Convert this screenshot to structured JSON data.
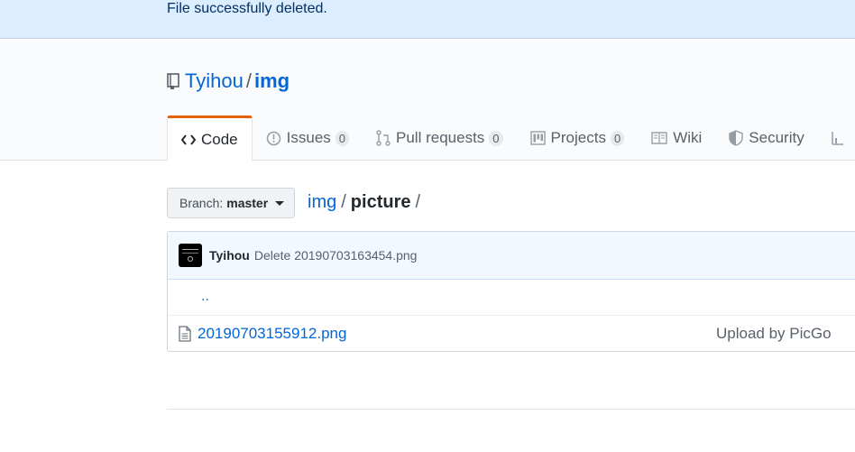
{
  "flash": {
    "message": "File successfully deleted."
  },
  "repo": {
    "owner": "Tyihou",
    "separator": "/",
    "name": "img"
  },
  "tabs": [
    {
      "label": "Code",
      "icon": "code-icon",
      "selected": true
    },
    {
      "label": "Issues",
      "icon": "issue-icon",
      "count": "0"
    },
    {
      "label": "Pull requests",
      "icon": "pull-request-icon",
      "count": "0"
    },
    {
      "label": "Projects",
      "icon": "project-icon",
      "count": "0"
    },
    {
      "label": "Wiki",
      "icon": "book-icon"
    },
    {
      "label": "Security",
      "icon": "shield-icon"
    }
  ],
  "branch": {
    "label": "Branch:",
    "value": "master"
  },
  "breadcrumb": {
    "root": "img",
    "sep": "/",
    "current": "picture"
  },
  "commit": {
    "author": "Tyihou",
    "message": "Delete 20190703163454.png"
  },
  "files": {
    "parent_link": "..",
    "rows": [
      {
        "name": "20190703155912.png",
        "commit_message": "Upload by PicGo"
      }
    ]
  },
  "colors": {
    "accent": "#e36209",
    "link": "#0366d6",
    "flash_bg": "#dbedff"
  }
}
